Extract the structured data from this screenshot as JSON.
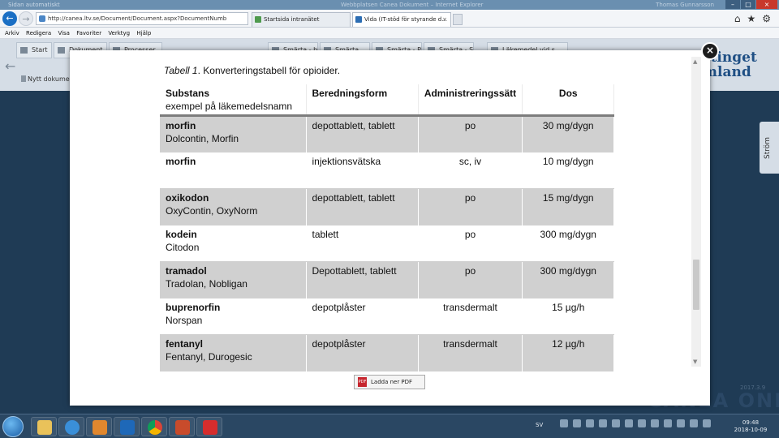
{
  "window": {
    "title_left": "Sidan automatiskt",
    "title_center": "Webbplatsen Canea Dokument – Internet Explorer",
    "title_right": "Thomas Gunnarsson"
  },
  "browser": {
    "url": "http://canea.ltv.se/Document/Document.aspx?DocumentNumb",
    "tabs": [
      {
        "label": "Startsida intranätet"
      },
      {
        "label": "Vida (IT-stöd för styrande d..."
      }
    ],
    "tab_close_glyph": "×",
    "icons": {
      "home": "⌂",
      "star": "★",
      "gear": "⚙"
    }
  },
  "menu": {
    "items": [
      "Arkiv",
      "Redigera",
      "Visa",
      "Favoriter",
      "Verktyg",
      "Hjälp"
    ]
  },
  "app": {
    "tabs": {
      "start": "Start",
      "dokument": "Dokument",
      "processer": "Processer",
      "smarta1": "Smärta - behand",
      "smarta2": "Smärta",
      "smarta3": "Smärta - Postop",
      "smarta4": "Smärta - Smärtl",
      "lakemedel": "Läkemedel vid s"
    },
    "new_doc": "Nytt dokument",
    "logo_line1": "stinget",
    "logo_line2": "mland",
    "side_tab": "Ström",
    "version": "2017.3.9",
    "brand": "CANEA ONE"
  },
  "modal": {
    "close_glyph": "×",
    "caption_prefix": "Tabell 1",
    "caption_text": ". Konverteringstabell för opioider.",
    "headers": {
      "substans": "Substans",
      "substans_sub": "exempel på läkemedelsnamn",
      "beredningsform": "Beredningsform",
      "administrering": "Administreringssätt",
      "dos": "Dos"
    },
    "rows": [
      {
        "substans": "morfin",
        "brand": "Dolcontin, Morfin",
        "form": "depottablett, tablett",
        "adm": "po",
        "dos": "30 mg/dygn"
      },
      {
        "substans": "morfin",
        "brand": "",
        "form": "injektionsvätska",
        "adm": "sc, iv",
        "dos": "10 mg/dygn"
      },
      {
        "substans": "oxikodon",
        "brand": "OxyContin, OxyNorm",
        "form": "depottablett, tablett",
        "adm": "po",
        "dos": "15 mg/dygn"
      },
      {
        "substans": "kodein",
        "brand": "Citodon",
        "form": "tablett",
        "adm": "po",
        "dos": "300 mg/dygn"
      },
      {
        "substans": "tramadol",
        "brand": "Tradolan, Nobligan",
        "form": "Depottablett, tablett",
        "adm": "po",
        "dos": "300 mg/dygn"
      },
      {
        "substans": "buprenorfin",
        "brand": "Norspan",
        "form": "depotplåster",
        "adm": "transdermalt",
        "dos": "15 µg/h"
      },
      {
        "substans": "fentanyl",
        "brand": "Fentanyl, Durogesic",
        "form": "depotplåster",
        "adm": "transdermalt",
        "dos": "12 µg/h"
      }
    ],
    "pdf_button": "Ladda ner PDF",
    "pdf_icon_text": "PDF"
  },
  "taskbar": {
    "language": "SV",
    "time": "09:48",
    "date": "2018-10-09"
  }
}
